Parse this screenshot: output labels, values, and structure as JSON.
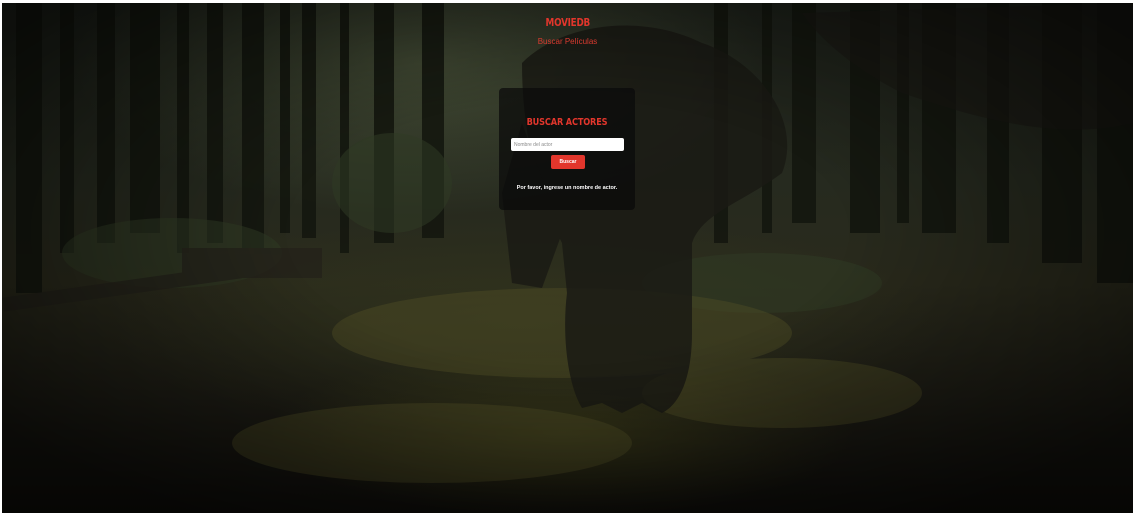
{
  "header": {
    "brand": "MOVIEDB",
    "nav_link": "Buscar Películas"
  },
  "search_card": {
    "title": "BUSCAR ACTORES",
    "input_placeholder": "Nombre del actor",
    "input_value": "",
    "button_label": "Buscar",
    "message": "Por favor, ingrese un nombre de actor."
  },
  "background": {
    "image": "forest-with-dinosaur-photo"
  },
  "colors": {
    "accent": "#e2362c",
    "card_background": "#0a0a0a",
    "text_light": "#ffffff"
  }
}
